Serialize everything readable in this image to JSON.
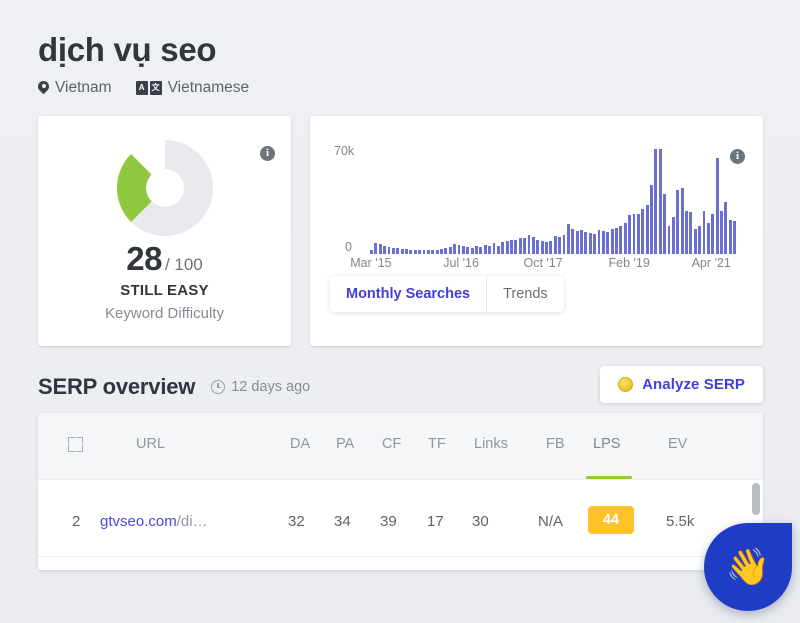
{
  "header": {
    "keyword": "dịch vụ seo",
    "location_icon": "pin-icon",
    "location": "Vietnam",
    "language_icon": "translate-icon",
    "language": "Vietnamese",
    "language_icon_left": "A",
    "language_icon_right": "文"
  },
  "keyword_difficulty": {
    "info_icon": "i",
    "score": "28",
    "out_of": "/ 100",
    "verdict": "STILL EASY",
    "caption": "Keyword Difficulty",
    "arc_color": "#8fc73e",
    "track_color": "#e7e9ec"
  },
  "volume_card": {
    "info_icon": "i",
    "tabs": [
      {
        "label": "Monthly Searches",
        "active": true
      },
      {
        "label": "Trends",
        "active": false
      }
    ]
  },
  "chart_data": {
    "type": "bar",
    "title": "Monthly Searches",
    "xlabel": "",
    "ylabel": "",
    "ylim": [
      0,
      70000
    ],
    "ytick_labels": [
      "70k",
      "0"
    ],
    "grid": false,
    "legend": null,
    "bar_color": "#6b6fd0",
    "xtick_labels": [
      "Mar '15",
      "Jul '16",
      "Oct '17",
      "Feb '19",
      "Apr '21"
    ],
    "xtick_positions_pct": [
      9,
      31,
      51,
      72,
      92
    ],
    "values": [
      2500,
      7500,
      6500,
      5500,
      4800,
      4200,
      3800,
      3500,
      3200,
      3000,
      2800,
      2600,
      2500,
      2400,
      2600,
      3000,
      3600,
      4200,
      4800,
      7000,
      6000,
      5200,
      4600,
      4200,
      5200,
      4400,
      6200,
      5200,
      7200,
      5600,
      8200,
      8800,
      9400,
      9600,
      10500,
      11000,
      13000,
      11500,
      9500,
      8500,
      8000,
      9000,
      12000,
      11500,
      12500,
      20000,
      17000,
      15500,
      16000,
      15000,
      14000,
      13500,
      16000,
      15500,
      14500,
      17000,
      17500,
      19000,
      21000,
      26000,
      26500,
      27000,
      30000,
      33000,
      46000,
      70000,
      70000,
      40000,
      19000,
      25000,
      43000,
      44000,
      29000,
      28000,
      17000,
      19000,
      29000,
      21000,
      27000,
      64000,
      29000,
      35000,
      23000,
      22000
    ]
  },
  "serp": {
    "title": "SERP overview",
    "clock_icon": "clock-icon",
    "updated": "12 days ago",
    "analyze_button": {
      "icon": "coin-icon",
      "label": "Analyze SERP"
    },
    "table": {
      "expand_icon": "expand-icon",
      "columns": [
        "URL",
        "DA",
        "PA",
        "CF",
        "TF",
        "Links",
        "FB",
        "LPS",
        "EV"
      ],
      "active_sort_column": "LPS",
      "rows": [
        {
          "rank": "2",
          "url_domain": "gtvseo.com",
          "url_path": "/di…",
          "da": "32",
          "pa": "34",
          "cf": "39",
          "tf": "17",
          "links": "30",
          "fb": "N/A",
          "lps": "44",
          "ev": "5.5k"
        }
      ]
    }
  },
  "chat_widget": {
    "icon": "waving-hand-icon",
    "glyph": "👋",
    "color": "#1f3dc4"
  }
}
